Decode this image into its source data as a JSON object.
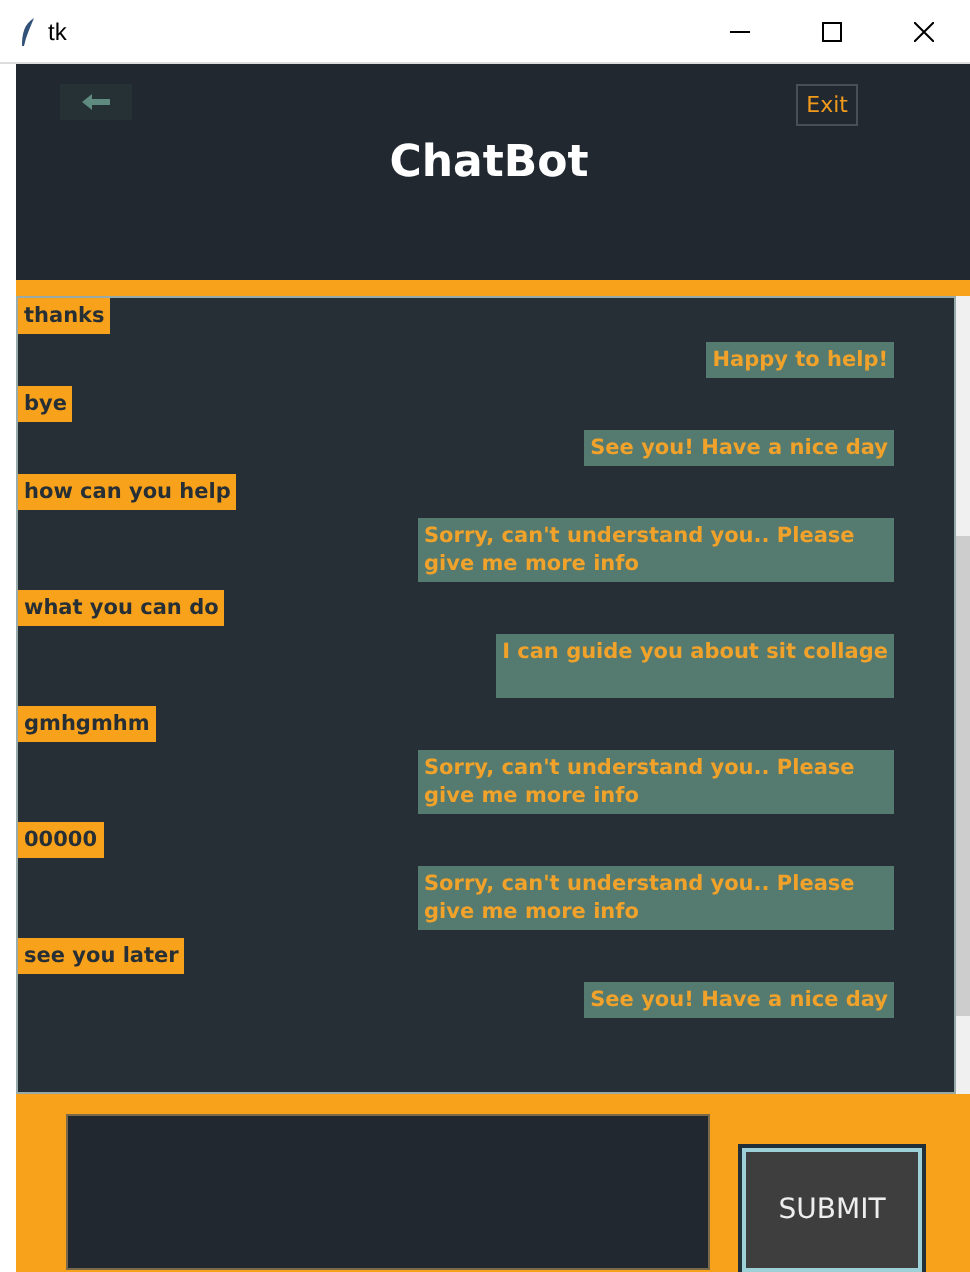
{
  "window": {
    "title": "tk"
  },
  "header": {
    "title": "ChatBot",
    "exit_button": "Exit"
  },
  "messages": [
    {
      "kind": "user",
      "text": "thanks"
    },
    {
      "kind": "bot",
      "text": "Happy to help!"
    },
    {
      "kind": "user",
      "text": "bye"
    },
    {
      "kind": "bot",
      "text": "See you! Have a nice day"
    },
    {
      "kind": "user",
      "text": "how can you help"
    },
    {
      "kind": "bot",
      "text": "Sorry, can't understand you.. Please give me more info"
    },
    {
      "kind": "user",
      "text": "what you can do"
    },
    {
      "kind": "bot",
      "text": "I can guide you about sit collage"
    },
    {
      "kind": "user",
      "text": "gmhgmhm"
    },
    {
      "kind": "bot",
      "text": "Sorry, can't understand you.. Please give me more info"
    },
    {
      "kind": "user",
      "text": "00000"
    },
    {
      "kind": "bot",
      "text": "Sorry, can't understand you.. Please give me more info"
    },
    {
      "kind": "user",
      "text": "see you later"
    },
    {
      "kind": "bot",
      "text": "See you! Have a nice day"
    }
  ],
  "composer": {
    "submit_button": "SUBMIT"
  }
}
